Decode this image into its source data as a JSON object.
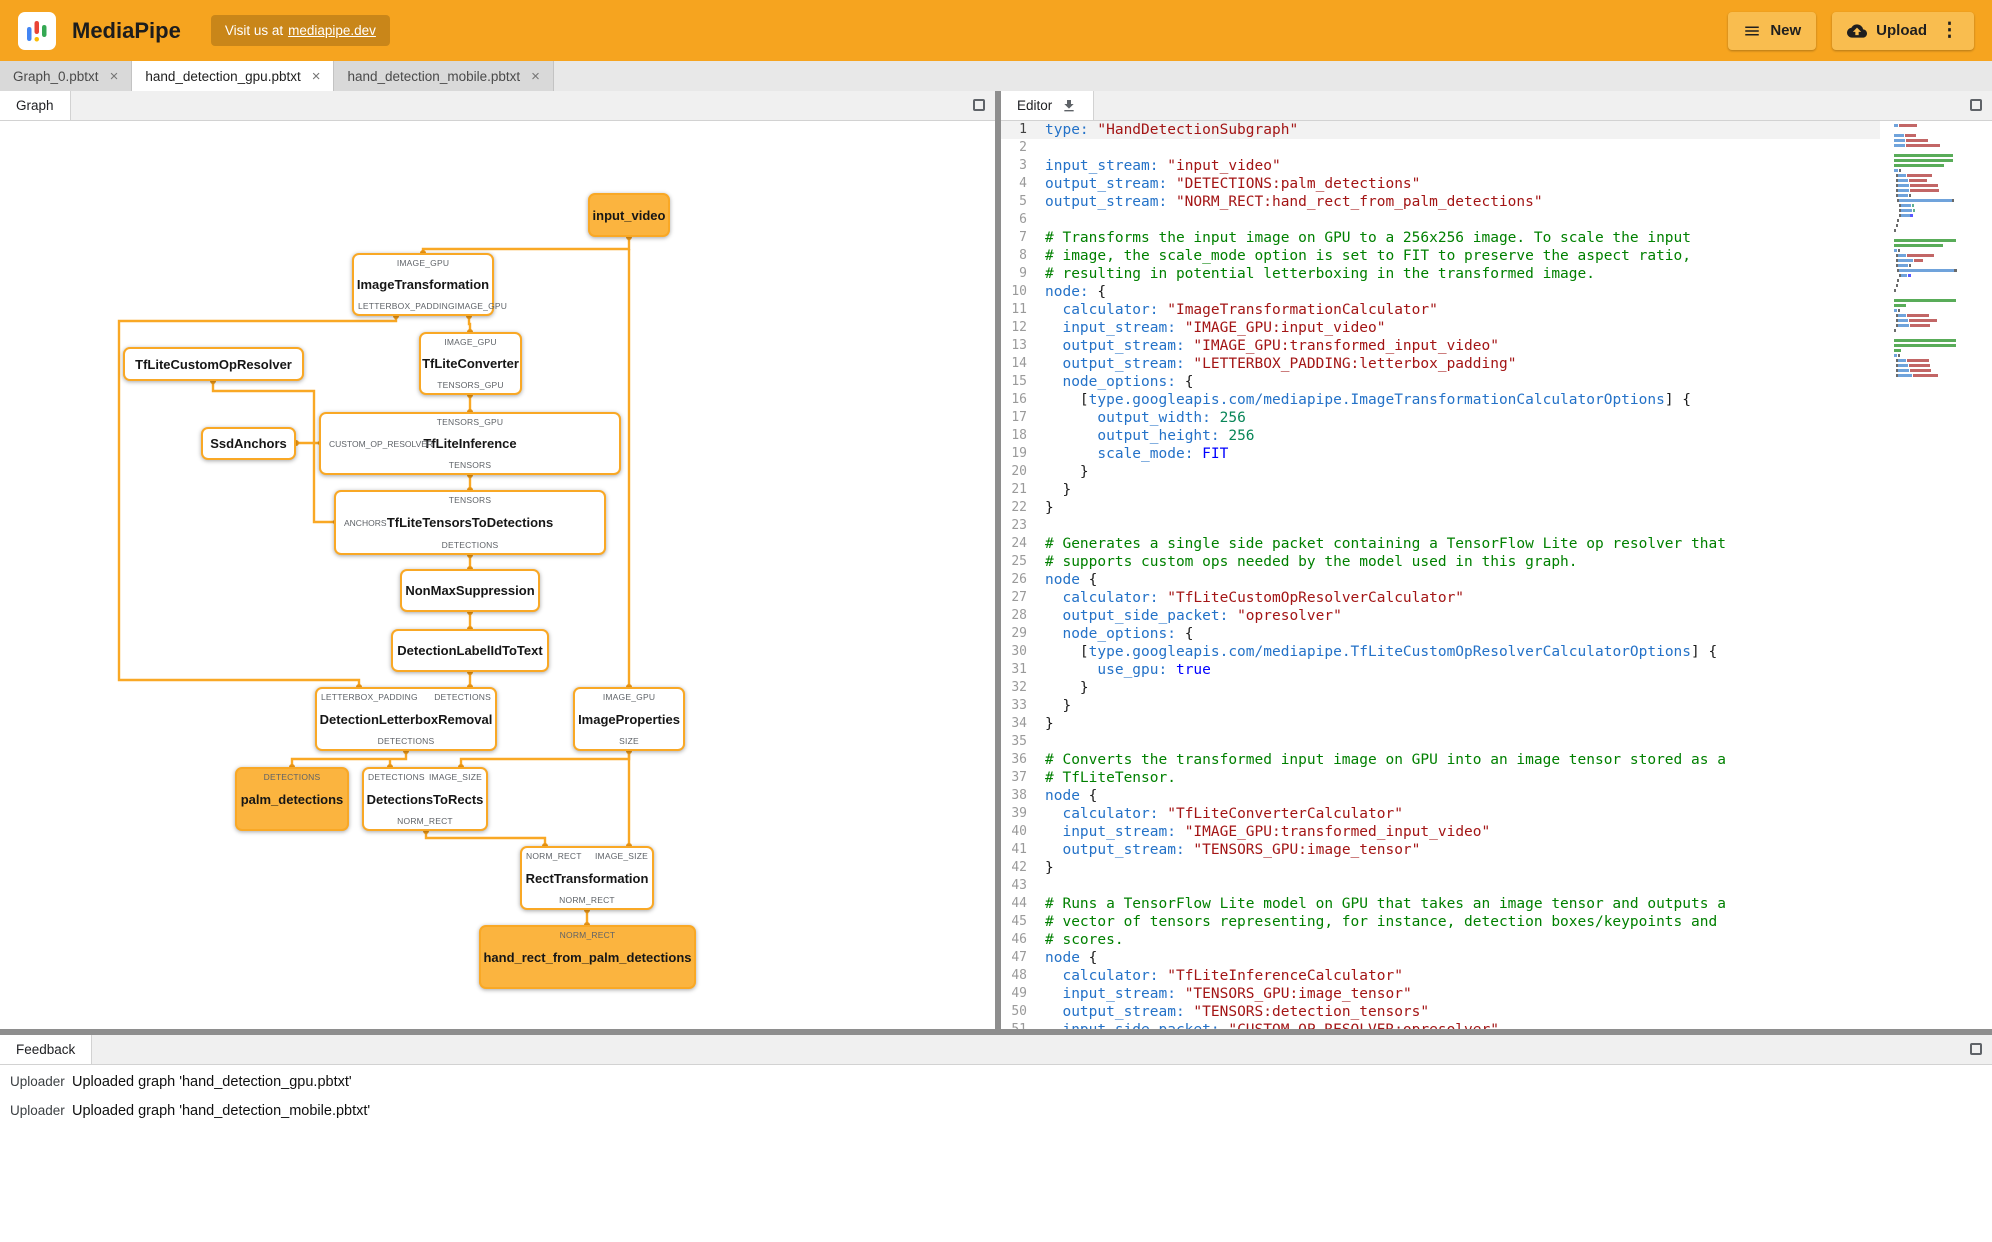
{
  "header": {
    "app_title": "MediaPipe",
    "visit_text": "Visit us at",
    "visit_link": "mediapipe.dev",
    "new_button": "New",
    "upload_button": "Upload"
  },
  "icons": {
    "close": "×",
    "kebab": "⋮"
  },
  "file_tabs": [
    {
      "label": "Graph_0.pbtxt",
      "active": false
    },
    {
      "label": "hand_detection_gpu.pbtxt",
      "active": true
    },
    {
      "label": "hand_detection_mobile.pbtxt",
      "active": false
    }
  ],
  "graph_panel": {
    "tab_label": "Graph",
    "nodes": {
      "input_video": {
        "label": "input_video",
        "type": "stream"
      },
      "image_transformation": {
        "label": "ImageTransformation",
        "ports_top": [
          "IMAGE_GPU"
        ],
        "ports_bottom": [
          "LETTERBOX_PADDING",
          "IMAGE_GPU"
        ]
      },
      "tflite_converter": {
        "label": "TfLiteConverter",
        "ports_top": [
          "IMAGE_GPU"
        ],
        "ports_bottom": [
          "TENSORS_GPU"
        ]
      },
      "tflite_custom_op_resolver": {
        "label": "TfLiteCustomOpResolver"
      },
      "ssd_anchors": {
        "label": "SsdAnchors"
      },
      "tflite_inference": {
        "label": "TfLiteInference",
        "ports_top": [
          "TENSORS_GPU"
        ],
        "port_left": "CUSTOM_OP_RESOLVER",
        "ports_bottom": [
          "TENSORS"
        ]
      },
      "tflite_tensors_to_detections": {
        "label": "TfLiteTensorsToDetections",
        "ports_top": [
          "TENSORS"
        ],
        "port_left": "ANCHORS",
        "ports_bottom": [
          "DETECTIONS"
        ]
      },
      "non_max_suppression": {
        "label": "NonMaxSuppression"
      },
      "detection_label_id_to_text": {
        "label": "DetectionLabelIdToText"
      },
      "detection_letterbox_removal": {
        "label": "DetectionLetterboxRemoval",
        "ports_top": [
          "LETTERBOX_PADDING",
          "DETECTIONS"
        ],
        "ports_bottom": [
          "DETECTIONS"
        ]
      },
      "image_properties": {
        "label": "ImageProperties",
        "ports_top": [
          "IMAGE_GPU"
        ],
        "ports_bottom": [
          "SIZE"
        ]
      },
      "palm_detections": {
        "label": "palm_detections",
        "type": "stream",
        "ports_top": [
          "DETECTIONS"
        ]
      },
      "detections_to_rects": {
        "label": "DetectionsToRects",
        "ports_top": [
          "DETECTIONS",
          "IMAGE_SIZE"
        ],
        "ports_bottom": [
          "NORM_RECT"
        ]
      },
      "rect_transformation": {
        "label": "RectTransformation",
        "ports_top": [
          "NORM_RECT",
          "IMAGE_SIZE"
        ],
        "ports_bottom": [
          "NORM_RECT"
        ]
      },
      "hand_rect_from_palm_detections": {
        "label": "hand_rect_from_palm_detections",
        "type": "stream",
        "ports_top": [
          "NORM_RECT"
        ]
      }
    }
  },
  "editor_panel": {
    "tab_label": "Editor",
    "token_colors": {
      "k": "#2472c8",
      "s": "#a31515",
      "c": "#008000",
      "n": "#098658",
      "b": "#0000ff",
      "p": "#1b1b1b"
    },
    "lines": [
      [
        [
          "k",
          "type:"
        ],
        [
          "s",
          " \"HandDetectionSubgraph\""
        ]
      ],
      [],
      [
        [
          "k",
          "input_stream:"
        ],
        [
          "s",
          " \"input_video\""
        ]
      ],
      [
        [
          "k",
          "output_stream:"
        ],
        [
          "s",
          " \"DETECTIONS:palm_detections\""
        ]
      ],
      [
        [
          "k",
          "output_stream:"
        ],
        [
          "s",
          " \"NORM_RECT:hand_rect_from_palm_detections\""
        ]
      ],
      [],
      [
        [
          "c",
          "# Transforms the input image on GPU to a 256x256 image. To scale the input"
        ]
      ],
      [
        [
          "c",
          "# image, the scale_mode option is set to FIT to preserve the aspect ratio,"
        ]
      ],
      [
        [
          "c",
          "# resulting in potential letterboxing in the transformed image."
        ]
      ],
      [
        [
          "k",
          "node:"
        ],
        [
          "p",
          " {"
        ]
      ],
      [
        [
          "p",
          "  "
        ],
        [
          "k",
          "calculator:"
        ],
        [
          "s",
          " \"ImageTransformationCalculator\""
        ]
      ],
      [
        [
          "p",
          "  "
        ],
        [
          "k",
          "input_stream:"
        ],
        [
          "s",
          " \"IMAGE_GPU:input_video\""
        ]
      ],
      [
        [
          "p",
          "  "
        ],
        [
          "k",
          "output_stream:"
        ],
        [
          "s",
          " \"IMAGE_GPU:transformed_input_video\""
        ]
      ],
      [
        [
          "p",
          "  "
        ],
        [
          "k",
          "output_stream:"
        ],
        [
          "s",
          " \"LETTERBOX_PADDING:letterbox_padding\""
        ]
      ],
      [
        [
          "p",
          "  "
        ],
        [
          "k",
          "node_options:"
        ],
        [
          "p",
          " {"
        ]
      ],
      [
        [
          "p",
          "    ["
        ],
        [
          "k",
          "type.googleapis.com/mediapipe.ImageTransformationCalculatorOptions"
        ],
        [
          "p",
          "] {"
        ]
      ],
      [
        [
          "p",
          "      "
        ],
        [
          "k",
          "output_width:"
        ],
        [
          "n",
          " 256"
        ]
      ],
      [
        [
          "p",
          "      "
        ],
        [
          "k",
          "output_height:"
        ],
        [
          "n",
          " 256"
        ]
      ],
      [
        [
          "p",
          "      "
        ],
        [
          "k",
          "scale_mode:"
        ],
        [
          "b",
          " FIT"
        ]
      ],
      [
        [
          "p",
          "    }"
        ]
      ],
      [
        [
          "p",
          "  }"
        ]
      ],
      [
        [
          "p",
          "}"
        ]
      ],
      [],
      [
        [
          "c",
          "# Generates a single side packet containing a TensorFlow Lite op resolver that"
        ]
      ],
      [
        [
          "c",
          "# supports custom ops needed by the model used in this graph."
        ]
      ],
      [
        [
          "k",
          "node"
        ],
        [
          "p",
          " {"
        ]
      ],
      [
        [
          "p",
          "  "
        ],
        [
          "k",
          "calculator:"
        ],
        [
          "s",
          " \"TfLiteCustomOpResolverCalculator\""
        ]
      ],
      [
        [
          "p",
          "  "
        ],
        [
          "k",
          "output_side_packet:"
        ],
        [
          "s",
          " \"opresolver\""
        ]
      ],
      [
        [
          "p",
          "  "
        ],
        [
          "k",
          "node_options:"
        ],
        [
          "p",
          " {"
        ]
      ],
      [
        [
          "p",
          "    ["
        ],
        [
          "k",
          "type.googleapis.com/mediapipe.TfLiteCustomOpResolverCalculatorOptions"
        ],
        [
          "p",
          "] {"
        ]
      ],
      [
        [
          "p",
          "      "
        ],
        [
          "k",
          "use_gpu:"
        ],
        [
          "b",
          " true"
        ]
      ],
      [
        [
          "p",
          "    }"
        ]
      ],
      [
        [
          "p",
          "  }"
        ]
      ],
      [
        [
          "p",
          "}"
        ]
      ],
      [],
      [
        [
          "c",
          "# Converts the transformed input image on GPU into an image tensor stored as a"
        ]
      ],
      [
        [
          "c",
          "# TfLiteTensor."
        ]
      ],
      [
        [
          "k",
          "node"
        ],
        [
          "p",
          " {"
        ]
      ],
      [
        [
          "p",
          "  "
        ],
        [
          "k",
          "calculator:"
        ],
        [
          "s",
          " \"TfLiteConverterCalculator\""
        ]
      ],
      [
        [
          "p",
          "  "
        ],
        [
          "k",
          "input_stream:"
        ],
        [
          "s",
          " \"IMAGE_GPU:transformed_input_video\""
        ]
      ],
      [
        [
          "p",
          "  "
        ],
        [
          "k",
          "output_stream:"
        ],
        [
          "s",
          " \"TENSORS_GPU:image_tensor\""
        ]
      ],
      [
        [
          "p",
          "}"
        ]
      ],
      [],
      [
        [
          "c",
          "# Runs a TensorFlow Lite model on GPU that takes an image tensor and outputs a"
        ]
      ],
      [
        [
          "c",
          "# vector of tensors representing, for instance, detection boxes/keypoints and"
        ]
      ],
      [
        [
          "c",
          "# scores."
        ]
      ],
      [
        [
          "k",
          "node"
        ],
        [
          "p",
          " {"
        ]
      ],
      [
        [
          "p",
          "  "
        ],
        [
          "k",
          "calculator:"
        ],
        [
          "s",
          " \"TfLiteInferenceCalculator\""
        ]
      ],
      [
        [
          "p",
          "  "
        ],
        [
          "k",
          "input_stream:"
        ],
        [
          "s",
          " \"TENSORS_GPU:image_tensor\""
        ]
      ],
      [
        [
          "p",
          "  "
        ],
        [
          "k",
          "output_stream:"
        ],
        [
          "s",
          " \"TENSORS:detection_tensors\""
        ]
      ],
      [
        [
          "p",
          "  "
        ],
        [
          "k",
          "input_side_packet:"
        ],
        [
          "s",
          " \"CUSTOM_OP_RESOLVER:opresolver\""
        ]
      ]
    ]
  },
  "feedback_panel": {
    "tab_label": "Feedback",
    "entries": [
      {
        "source": "Uploader",
        "message": "Uploaded graph 'hand_detection_gpu.pbtxt'"
      },
      {
        "source": "Uploader",
        "message": "Uploaded graph 'hand_detection_mobile.pbtxt'"
      }
    ]
  },
  "colors": {
    "header_bg": "#f6a41f",
    "accent": "#f9a825",
    "stream_node_fill": "#fbb43f"
  }
}
